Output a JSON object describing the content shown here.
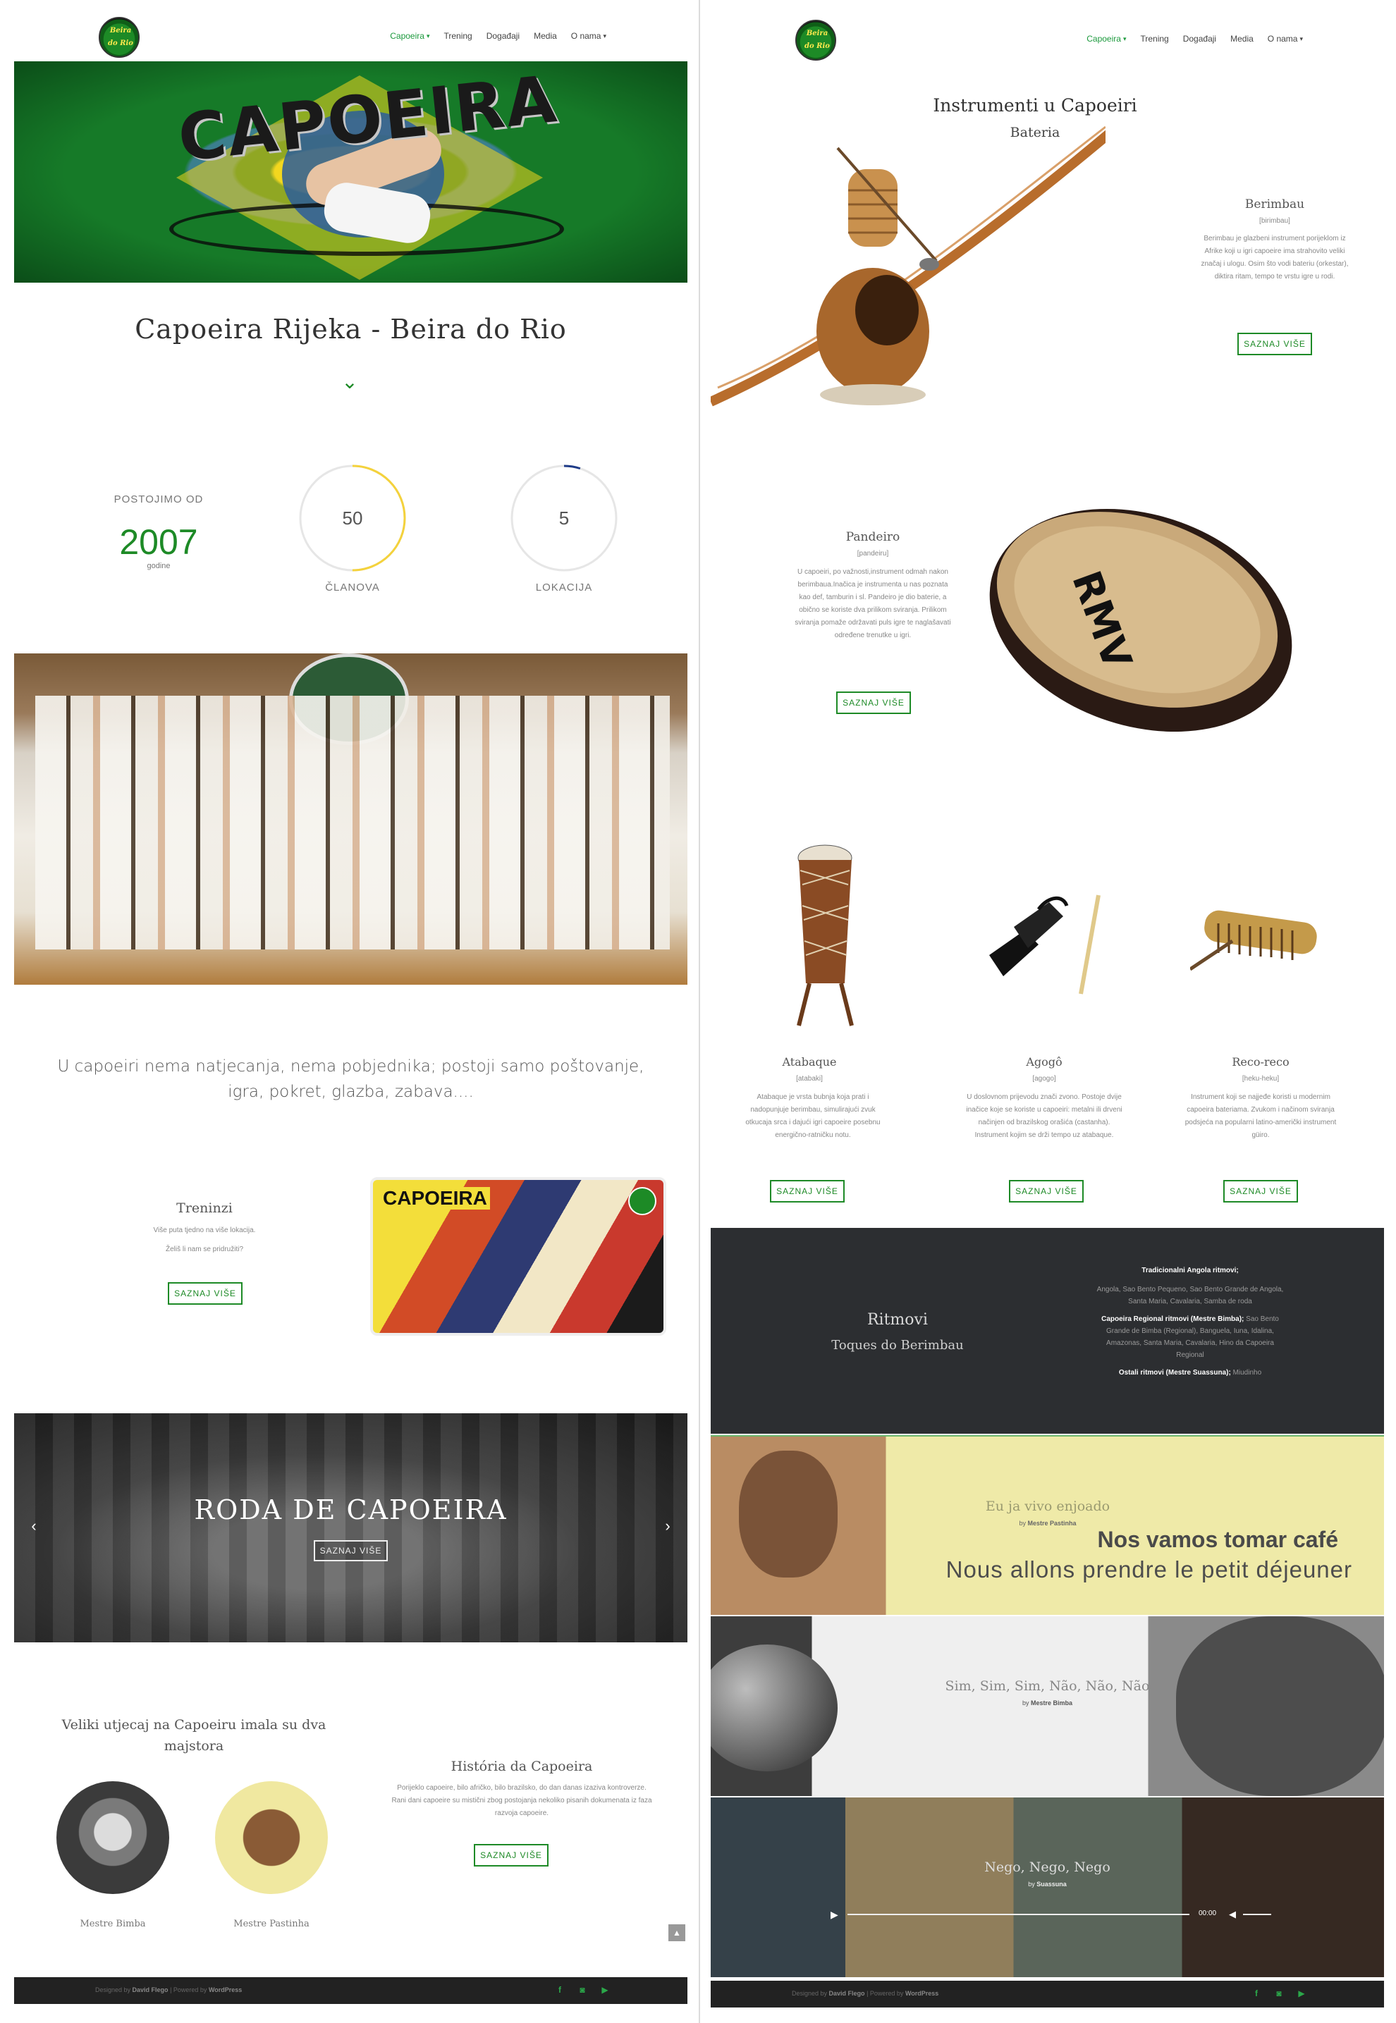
{
  "left": {
    "logo": {
      "line1": "Beira",
      "line2": "do Rio"
    },
    "nav": [
      {
        "label": "Capoeira",
        "has_caret": true,
        "active": true
      },
      {
        "label": "Trening",
        "has_caret": false,
        "active": false
      },
      {
        "label": "Događaji",
        "has_caret": false,
        "active": false
      },
      {
        "label": "Media",
        "has_caret": false,
        "active": false
      },
      {
        "label": "O nama",
        "has_caret": true,
        "active": false
      }
    ],
    "hero_word": "CAPOEIRA",
    "page_title": "Capoeira Rijeka - Beira do Rio",
    "stats": {
      "since_label": "POSTOJIMO OD",
      "since_year": "2007",
      "since_sub": "godine",
      "members_value": "50",
      "members_label": "ČLANOVA",
      "members_fraction": 0.5,
      "locations_value": "5",
      "locations_label": "LOKACIJA",
      "locations_fraction": 0.05
    },
    "quote": "U capoeiri nema natjecanja, nema pobjednika; postoji samo poštovanje, igra, pokret, glazba, zabava....",
    "training": {
      "title": "Treninzi",
      "line1": "Više puta tjedno na više lokacija.",
      "line2": "Želiš li nam se pridružiti?",
      "button": "SAZNAJ VIŠE",
      "image_word": "CAPOEIRA"
    },
    "slider": {
      "title": "RODA DE CAPOEIRA",
      "button": "SAZNAJ VIŠE",
      "prev": "‹",
      "next": "›"
    },
    "masters": {
      "heading": "Veliki utjecaj na Capoeiru imala su dva majstora",
      "name1": "Mestre Bimba",
      "name2": "Mestre Pastinha"
    },
    "history": {
      "title": "História da Capoeira",
      "text": "Porijeklo capoeire, bilo afričko, bilo brazilsko, do dan danas izaziva kontroverze. Rani dani capoeire su mistični zbog postojanja nekoliko pisanih dokumenata iz faza razvoja capoeire.",
      "button": "SAZNAJ VIŠE"
    },
    "footer": {
      "prefix": "Designed by ",
      "designer": "David Flego",
      "mid": " | Powered by ",
      "platform": "WordPress"
    }
  },
  "right": {
    "nav": [
      {
        "label": "Capoeira",
        "has_caret": true,
        "active": true
      },
      {
        "label": "Trening",
        "has_caret": false,
        "active": false
      },
      {
        "label": "Događaji",
        "has_caret": false,
        "active": false
      },
      {
        "label": "Media",
        "has_caret": false,
        "active": false
      },
      {
        "label": "O nama",
        "has_caret": true,
        "active": false
      }
    ],
    "instruments_title": "Instrumenti u Capoeiri",
    "instruments_sub": "Bateria",
    "berimbau": {
      "title": "Berimbau",
      "pron": "[birimbau]",
      "text": "Berimbau je glazbeni instrument porijeklom iz Afrike koji u igri capoeire ima strahovito veliki značaj i ulogu. Osim što vodi bateriu (orkestar), diktira ritam, tempo te vrstu igre u rodi.",
      "button": "SAZNAJ VIŠE"
    },
    "pandeiro": {
      "title": "Pandeiro",
      "pron": "[pandeiru]",
      "text": "U capoeiri, po važnosti,instrument odmah nakon berimbaua.Inačica je instrumenta u nas poznata kao def, tamburin i sl. Pandeiro je dio baterie, a obično se koriste dva prilikom sviranja. Prilikom sviranja pomaže održavati puls igre te naglašavati određene trenutke u igri.",
      "button": "SAZNAJ VIŠE",
      "drum_text": "RMV"
    },
    "small": [
      {
        "title": "Atabaque",
        "pron": "[atabaki]",
        "text": "Atabaque je vrsta bubnja koja prati i nadopunjuje berimbau, simulirajući zvuk otkucaja srca i dajući igri capoeire posebnu energično-ratničku notu.",
        "button": "SAZNAJ VIŠE"
      },
      {
        "title": "Agogô",
        "pron": "[agogo]",
        "text": "U doslovnom prijevodu znači zvono. Postoje dvije inačice koje se koriste u capoeiri: metalni ili drveni načinjen od brazilskog orašića (castanha). Instrument kojim se drži tempo uz atabaque.",
        "button": "SAZNAJ VIŠE"
      },
      {
        "title": "Reco-reco",
        "pron": "[heku-heku]",
        "text": "Instrument koji se najjeđe koristi u modernim capoeira bateriama. Zvukom i načinom sviranja podsjeća na popularni latino-američki instrument güiro.",
        "button": "SAZNAJ VIŠE"
      }
    ],
    "rhythms": {
      "title": "Ritmovi",
      "subtitle": "Toques do Berimbau",
      "angola_head": "Tradicionalni Angola ritmovi;",
      "angola_list": "Angola, Sao Bento Pequeno, Sao Bento Grande de Angola, Santa Maria, Cavalaria, Samba de roda",
      "regional_head": "Capoeira Regional ritmovi (Mestre Bimba);",
      "regional_list": "Sao Bento Grande de Bimba (Regional), Banguela, Iuna, Idalina, Amazonas, Santa Maria, Cavalaria, Hino da Capoeira Regional",
      "other_head": "Ostali ritmovi (Mestre Suassuna);",
      "other_list": "Miudinho"
    },
    "songs": [
      {
        "title": "Eu ja vivo enjoado",
        "by": "by",
        "author": "Mestre Pastinha",
        "big1": "Nos vamos tomar café",
        "big2": "Nous allons prendre le petit déjeuner"
      },
      {
        "title": "Sim, Sim, Sim, Não, Não, Não",
        "by": "by",
        "author": "Mestre Bimba"
      },
      {
        "title": "Nego, Nego, Nego",
        "by": "by",
        "author": "Suassuna",
        "time": "00:00"
      }
    ],
    "footer": {
      "prefix": "Designed by ",
      "designer": "David Flego",
      "mid": " | Powered by ",
      "platform": "WordPress"
    }
  },
  "colors": {
    "accent": "#1d8a26",
    "ring_members": "#f4d23c",
    "ring_locations": "#1f3c88",
    "footer": "#222222",
    "rhythms_bg": "#2c2e31"
  }
}
